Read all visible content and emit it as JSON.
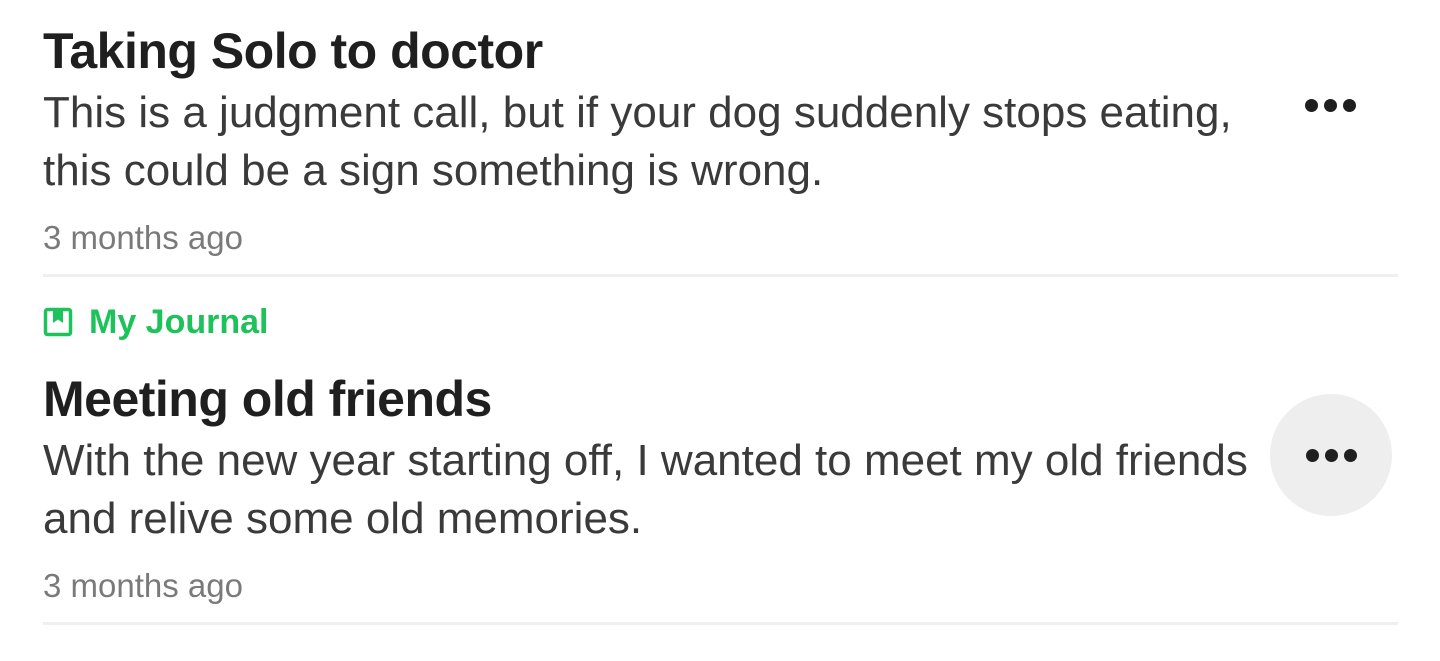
{
  "entries": [
    {
      "title": "Taking Solo to doctor",
      "body": "This is a judgment call, but if your dog suddenly stops eating, this could be a sign something is wrong.",
      "time": "3 months ago",
      "more_icon": "more-horizontal-icon"
    },
    {
      "journal": {
        "label": "My Journal",
        "icon": "journal-book-icon",
        "color": "#1ec25a"
      },
      "title": "Meeting old friends",
      "body": "With the new year starting off, I wanted to meet my old friends and relive some old memories.",
      "time": "3 months ago",
      "more_icon": "more-horizontal-icon",
      "more_pressed": true
    }
  ],
  "colors": {
    "accent": "#1ec25a",
    "title": "#1f1f1f",
    "body": "#3a3a3a",
    "timestamp": "#7a7a7a",
    "divider": "#efefef",
    "pressed_bg": "#eeeeee"
  }
}
